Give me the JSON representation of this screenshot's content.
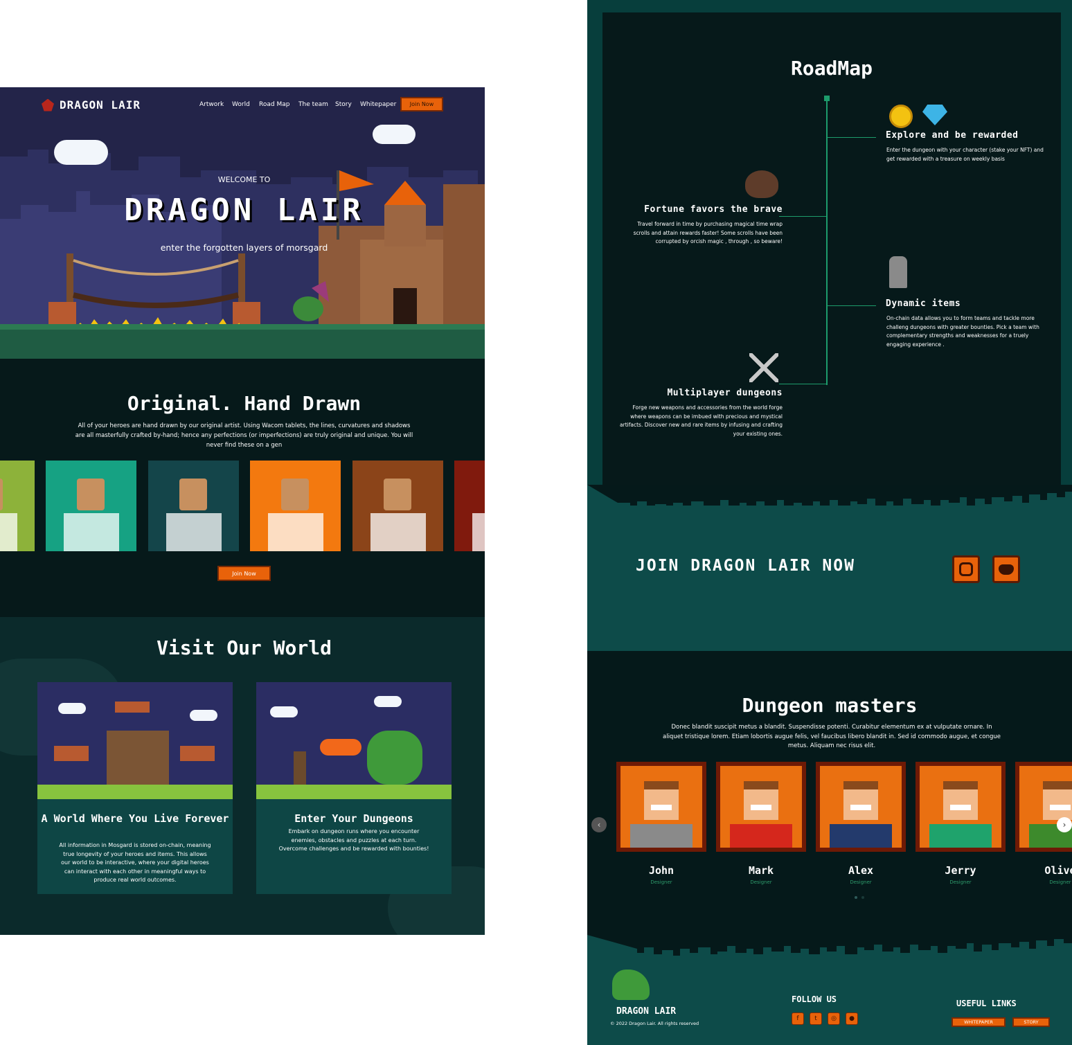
{
  "brand": {
    "name": "DRAGON LAIR"
  },
  "nav": {
    "items": [
      "Artwork",
      "World",
      "Road Map",
      "The team",
      "Story",
      "Whitepaper"
    ],
    "cta": "Join Now"
  },
  "hero": {
    "welcome": "WELCOME TO",
    "title": "DRAGON LAIR",
    "subtitle": "enter the forgotten layers of morsgard"
  },
  "artwork": {
    "title": "Original. Hand Drawn",
    "text": "All of your heroes are hand drawn by our original artist. Using Wacom tablets, the lines, curvatures and shadows are all masterfully crafted by-hand; hence any perfections (or imperfections) are truly original and unique. You will never find these on a gen",
    "cta": "Join Now",
    "tile_colors": [
      "#8db23a",
      "#16a283",
      "#14454a",
      "#f3790f",
      "#8b4419",
      "#801a0d"
    ]
  },
  "world": {
    "title": "Visit Our World",
    "cards": [
      {
        "title": "A World Where You Live Forever",
        "text": "All information in Mosgard is stored on-chain, meaning true longevity of your heroes and items. This allows our world to be interactive, where your digital heroes can interact with each other in meaningful ways to produce real world outcomes."
      },
      {
        "title": "Enter Your Dungeons",
        "text": "Embark on dungeon runs where you encounter enemies, obstacles and puzzles at each turn. Overcome challenges and be rewarded with bounties!"
      }
    ]
  },
  "roadmap": {
    "title": "RoadMap",
    "items": [
      {
        "title": "Explore and be rewarded",
        "text": "Enter the dungeon with your character (stake your NFT) and get rewarded with a treasure on weekly basis"
      },
      {
        "title": "Fortune favors the brave",
        "text": "Travel forward in time by purchasing magical time wrap scrolls and attain rewards faster! Some scrolls have been corrupted by orcish magic , through , so beware!"
      },
      {
        "title": "Dynamic items",
        "text": "On-chain data allows you to form teams and tackle more challeng dungeons with greater bounties. Pick a team with complementary strengths and weaknesses for a truely engaging experience ."
      },
      {
        "title": "Multiplayer dungeons",
        "text": "Forge new weapons and accessories from the world forge where weapons can be imbued with precious and mystical artifacts. Discover new and rare items by infusing and crafting your existing ones."
      }
    ]
  },
  "join": {
    "title": "JOIN DRAGON LAIR NOW"
  },
  "masters": {
    "title": "Dungeon masters",
    "text": "Donec blandit suscipit metus a blandit. Suspendisse potenti. Curabitur elementum ex at vulputate ornare. In aliquet tristique lorem. Etiam lobortis augue felis, vel faucibus libero blandit in. Sed id commodo augue, et congue metus. Aliquam nec risus elit.",
    "people": [
      {
        "name": "John",
        "role": "Designer",
        "shirt": "#8a8a8a"
      },
      {
        "name": "Mark",
        "role": "Designer",
        "shirt": "#d5271c"
      },
      {
        "name": "Alex",
        "role": "Designer",
        "shirt": "#233a6c"
      },
      {
        "name": "Jerry",
        "role": "Designer",
        "shirt": "#1fa36c"
      },
      {
        "name": "Olive",
        "role": "Designer",
        "shirt": "#3d8a2c"
      }
    ]
  },
  "footer": {
    "brand": "DRAGON LAIR",
    "copyright": "© 2022 Dragon Lair. All rights reserved",
    "follow": "FOLLOW US",
    "useful": "USEFUL LINKS",
    "links": [
      "WHITEPAPER",
      "STORY"
    ]
  },
  "colors": {
    "accent": "#e8620a",
    "dark_teal": "#06191a",
    "mid_teal": "#0d4b49",
    "hero_sky": "#232449"
  }
}
